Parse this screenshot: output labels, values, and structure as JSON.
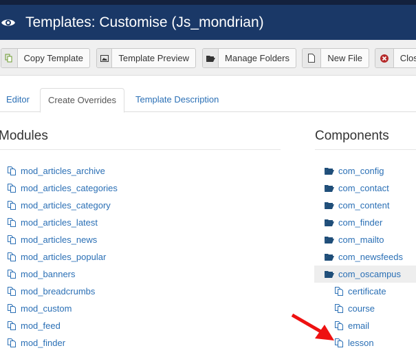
{
  "header": {
    "title": "Templates: Customise (Js_mondrian)",
    "icon": "eye-icon"
  },
  "toolbar": [
    {
      "label": "Copy Template",
      "icon": "copy-icon"
    },
    {
      "label": "Template Preview",
      "icon": "image-icon"
    },
    {
      "label": "Manage Folders",
      "icon": "folder-icon"
    },
    {
      "label": "New File",
      "icon": "file-icon"
    },
    {
      "label": "Close",
      "icon": "close-circle-icon"
    }
  ],
  "tabs": [
    {
      "label": "Editor"
    },
    {
      "label": "Create Overrides",
      "active": true
    },
    {
      "label": "Template Description"
    }
  ],
  "modules": {
    "title": "Modules",
    "items": [
      "mod_articles_archive",
      "mod_articles_categories",
      "mod_articles_category",
      "mod_articles_latest",
      "mod_articles_news",
      "mod_articles_popular",
      "mod_banners",
      "mod_breadcrumbs",
      "mod_custom",
      "mod_feed",
      "mod_finder"
    ]
  },
  "components": {
    "title": "Components",
    "items": [
      {
        "label": "com_config",
        "type": "folder"
      },
      {
        "label": "com_contact",
        "type": "folder"
      },
      {
        "label": "com_content",
        "type": "folder"
      },
      {
        "label": "com_finder",
        "type": "folder"
      },
      {
        "label": "com_mailto",
        "type": "folder"
      },
      {
        "label": "com_newsfeeds",
        "type": "folder"
      },
      {
        "label": "com_oscampus",
        "type": "folder-open",
        "selected": true
      },
      {
        "label": "certificate",
        "type": "file"
      },
      {
        "label": "course",
        "type": "file"
      },
      {
        "label": "email",
        "type": "file"
      },
      {
        "label": "lesson",
        "type": "file"
      }
    ]
  },
  "colors": {
    "header": "#1a3867",
    "link": "#2a6fb5",
    "arrow": "#ee1111"
  }
}
